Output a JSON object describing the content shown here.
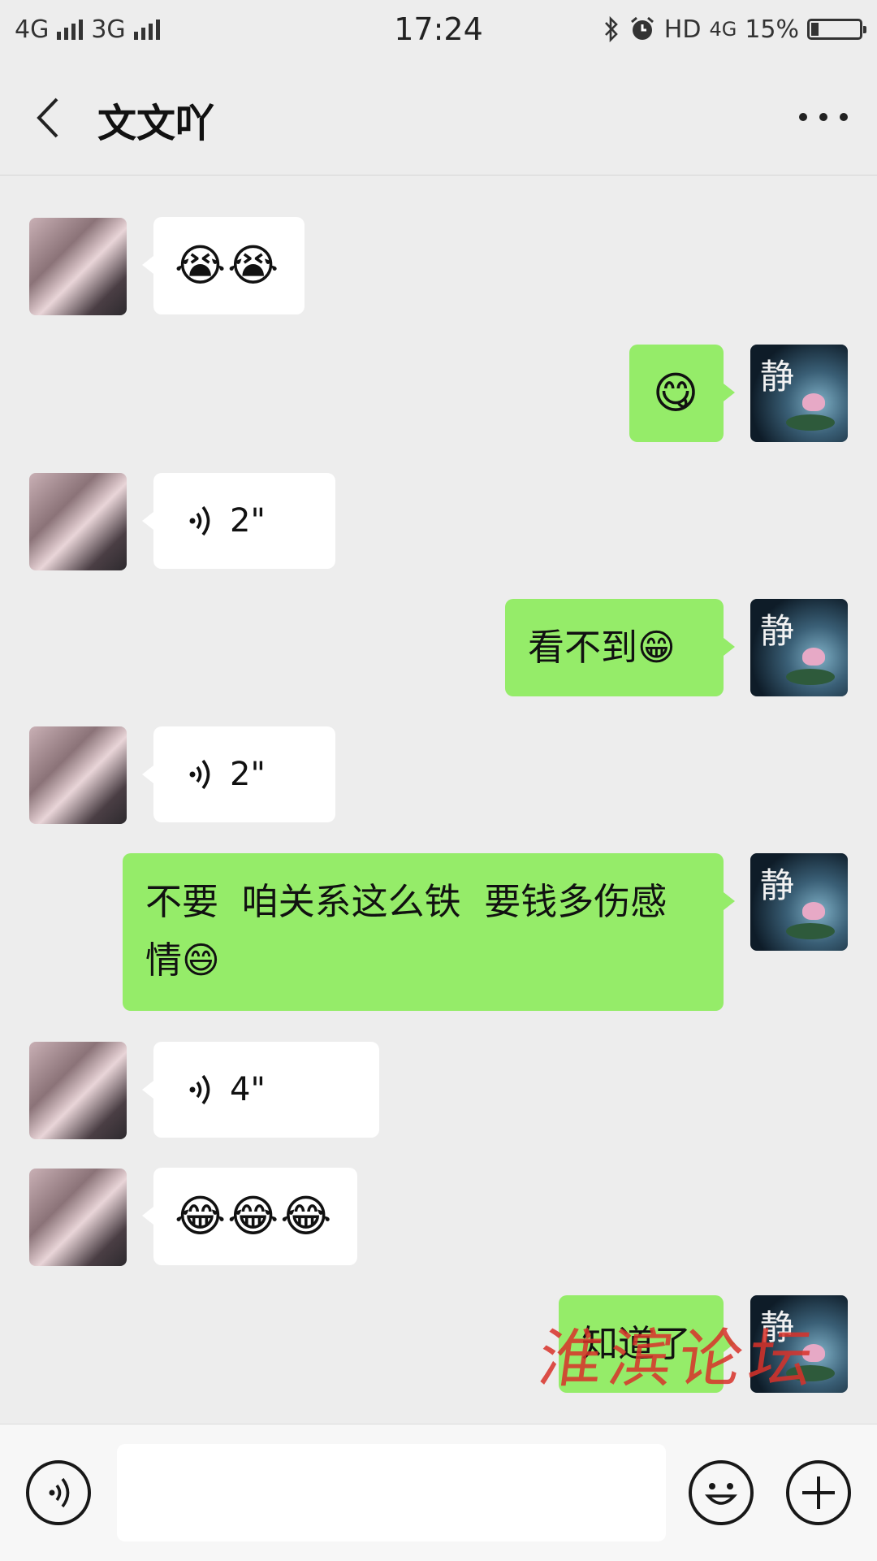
{
  "status_bar": {
    "left_network_1": "4G",
    "left_network_2": "3G",
    "time": "17:24",
    "right_hd": "HD",
    "right_network": "4G",
    "battery_percent_text": "15%",
    "battery_level": 0.15,
    "icons": [
      "bluetooth-icon",
      "alarm-icon",
      "battery-icon"
    ]
  },
  "nav": {
    "title": "文文吖",
    "back_icon": "chevron-left-icon",
    "more_icon": "more-dots-icon"
  },
  "messages": [
    {
      "side": "left",
      "type": "emoji",
      "content": "😭😭"
    },
    {
      "side": "right",
      "type": "emoji",
      "content": "😋"
    },
    {
      "side": "left",
      "type": "voice",
      "duration": "2\""
    },
    {
      "side": "right",
      "type": "text",
      "content": "看不到😁"
    },
    {
      "side": "left",
      "type": "voice",
      "duration": "2\""
    },
    {
      "side": "right",
      "type": "text",
      "content": "不要  咱关系这么铁  要钱多伤感情😄"
    },
    {
      "side": "left",
      "type": "voice",
      "duration": "4\""
    },
    {
      "side": "left",
      "type": "emoji",
      "content": "😂😂😂"
    },
    {
      "side": "right",
      "type": "text",
      "content": "知道了"
    }
  ],
  "avatars": {
    "me_char": "静"
  },
  "watermark": "淮滨论坛",
  "input_bar": {
    "voice_icon": "voice-input-icon",
    "emoji_icon": "emoji-icon",
    "plus_icon": "plus-icon",
    "input_value": ""
  },
  "colors": {
    "background": "#ededed",
    "bubble_me": "#95ec69",
    "bubble_friend": "#ffffff",
    "watermark": "#d9322a"
  }
}
